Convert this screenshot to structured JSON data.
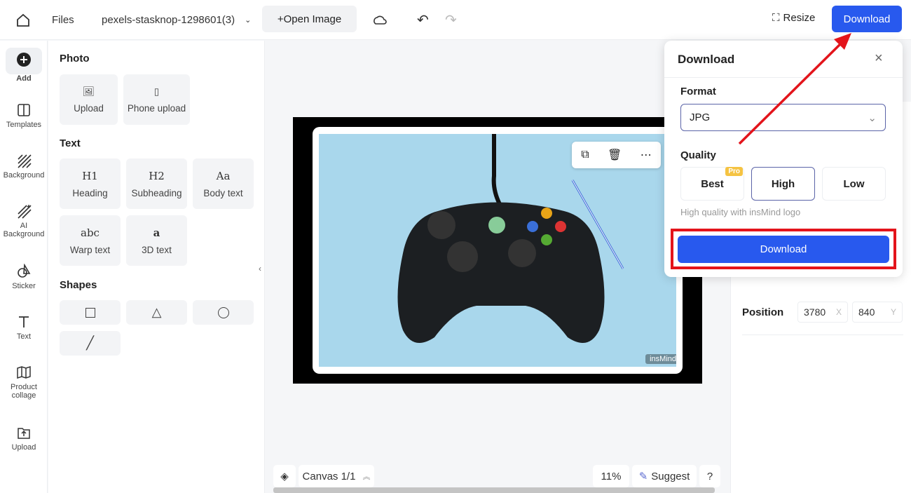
{
  "topbar": {
    "files": "Files",
    "filename": "pexels-stasknop-1298601(3)",
    "open_image": "+Open Image",
    "resize": "Resize",
    "download": "Download"
  },
  "rail": [
    {
      "label": "Add",
      "icon": "plus-circle-icon"
    },
    {
      "label": "Templates",
      "icon": "templates-icon"
    },
    {
      "label": "Background",
      "icon": "background-icon"
    },
    {
      "label": "AI Background",
      "icon": "ai-background-icon"
    },
    {
      "label": "Sticker",
      "icon": "sticker-icon"
    },
    {
      "label": "Text",
      "icon": "text-icon"
    },
    {
      "label": "Product collage",
      "icon": "collage-icon"
    },
    {
      "label": "Upload",
      "icon": "upload-icon"
    }
  ],
  "panel": {
    "photo": "Photo",
    "upload": "Upload",
    "phone_upload": "Phone upload",
    "text": "Text",
    "text_items": [
      {
        "glyph": "H1",
        "label": "Heading"
      },
      {
        "glyph": "H2",
        "label": "Subheading"
      },
      {
        "glyph": "Aa",
        "label": "Body text"
      },
      {
        "glyph": "abc",
        "label": "Warp text"
      },
      {
        "glyph": "a",
        "label": "3D text"
      }
    ],
    "shapes": "Shapes"
  },
  "canvas": {
    "watermark": "insMind"
  },
  "bottom": {
    "canvas": "Canvas 1/1",
    "zoom": "11%",
    "suggest": "Suggest",
    "help": "?"
  },
  "right": {
    "position": "Position",
    "x": "3780",
    "x_label": "X",
    "y": "840",
    "y_label": "Y"
  },
  "popup": {
    "title": "Download",
    "format_label": "Format",
    "format": "JPG",
    "quality_label": "Quality",
    "qualities": [
      "Best",
      "High",
      "Low"
    ],
    "selected": "High",
    "pro": "Pro",
    "hint": "High quality with insMind logo",
    "download": "Download"
  },
  "colors": {
    "accent": "#2859ee",
    "annotation": "#e3141b"
  }
}
